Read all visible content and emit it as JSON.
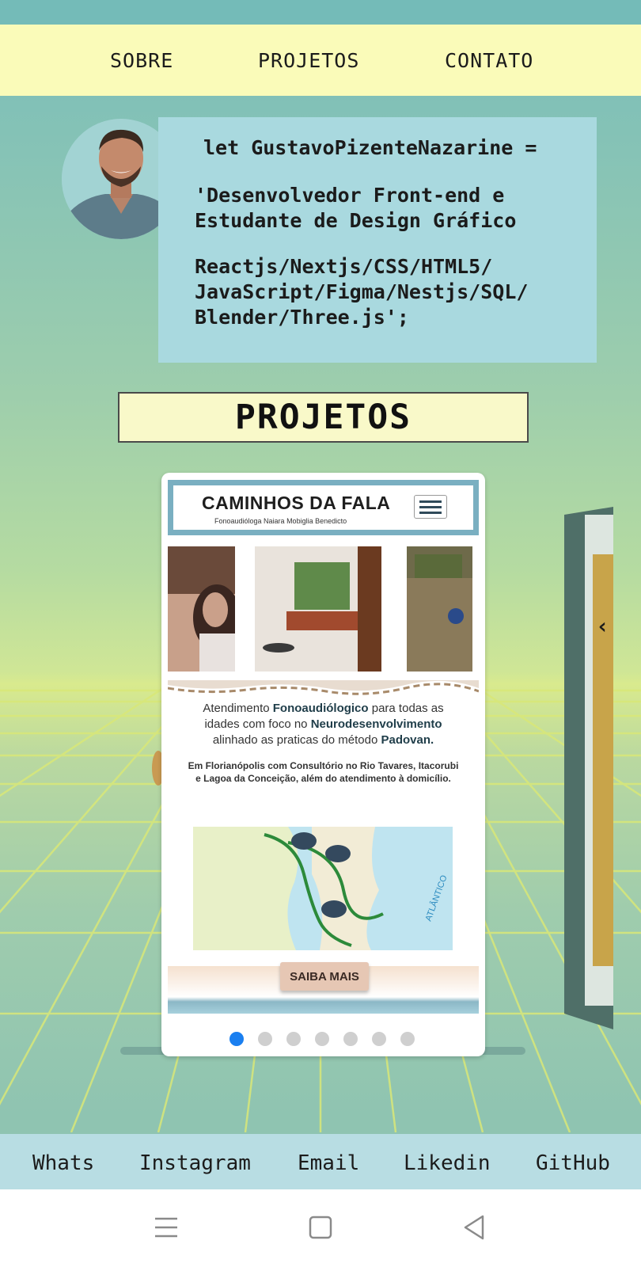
{
  "nav": {
    "items": [
      "SOBRE",
      "PROJETOS",
      "CONTATO"
    ]
  },
  "intro": {
    "line1": "let GustavoPizenteNazarine =",
    "line2": "'Desenvolvedor Front-end e",
    "line3": "Estudante de Design Gráfico",
    "line4": "Reactjs/Nextjs/CSS/HTML5/",
    "line5": "JavaScript/Figma/Nestjs/SQL/",
    "line6": "Blender/Three.js';"
  },
  "projects": {
    "title": "PROJETOS"
  },
  "card": {
    "brand": "CAMINHOS DA FALA",
    "subtitle": "Fonoaudióloga Naiara Mobiglia Benedicto",
    "p1_a": "Atendimento ",
    "p1_b": "Fonoaudiólogico",
    "p1_c": " para todas as idades com foco no ",
    "p1_d": "Neurodesenvolvimento",
    "p1_e": " alinhado as praticas do método ",
    "p1_f": "Padovan.",
    "p2": "Em Florianópolis com Consultório no Rio Tavares, Itacorubi e Lagoa da Conceição, além do atendimento à domicílio.",
    "button": "SAIBA MAIS",
    "map_label": "ATLÂNTICO",
    "dots_total": 7,
    "dots_active": 0
  },
  "carousel": {
    "next_arrow": "‹"
  },
  "links": [
    "Whats",
    "Instagram",
    "Email",
    "Likedin",
    "GitHub"
  ],
  "icons": {
    "menu": "menu-icon",
    "home": "square-home-icon",
    "back": "triangle-back-icon"
  },
  "colors": {
    "nav_bg": "#fafbb9",
    "intro_bg": "#a9d9df",
    "title_bg": "#f9f9c9",
    "links_bg": "#b8dde3",
    "card_border": "#7aafc1",
    "dot_active": "#1a7ff0"
  }
}
